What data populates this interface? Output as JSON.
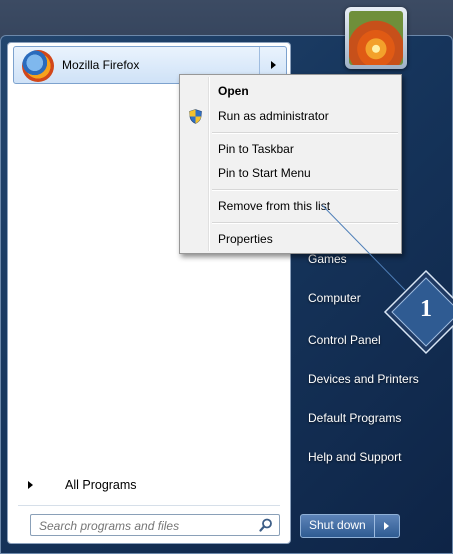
{
  "left_pane": {
    "pinned_program": {
      "label": "Mozilla Firefox",
      "icon": "firefox-icon"
    },
    "all_programs_label": "All Programs",
    "search_placeholder": "Search programs and files"
  },
  "right_pane": {
    "items": [
      {
        "label": "Games"
      },
      {
        "label": "Computer"
      },
      {
        "label": "Control Panel"
      },
      {
        "label": "Devices and Printers"
      },
      {
        "label": "Default Programs"
      },
      {
        "label": "Help and Support"
      }
    ],
    "shutdown_label": "Shut down"
  },
  "context_menu": {
    "items": [
      {
        "label": "Open",
        "bold": true
      },
      {
        "label": "Run as administrator",
        "icon": "uac-shield-icon"
      },
      {
        "label": "Pin to Taskbar"
      },
      {
        "label": "Pin to Start Menu"
      },
      {
        "label": "Remove from this list"
      },
      {
        "label": "Properties"
      }
    ]
  },
  "callout": {
    "number": "1"
  },
  "colors": {
    "accent": "#16355c",
    "callout": "#2f4c73",
    "highlight": "#cfe2f7"
  }
}
